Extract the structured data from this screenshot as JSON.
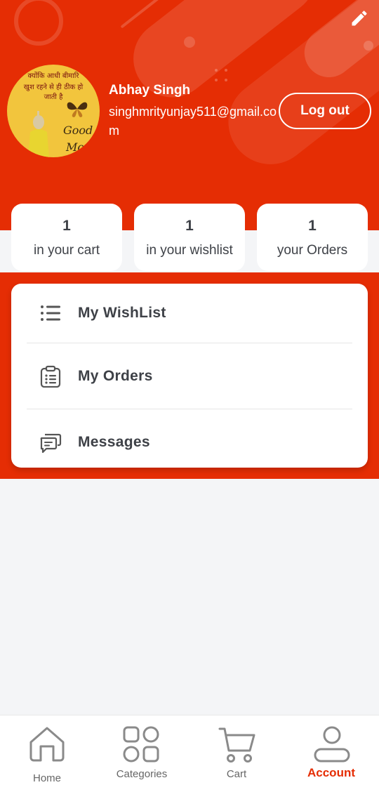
{
  "header": {
    "user_name": "Abhay Singh",
    "user_email": "singhmrityunjay511@gmail.com",
    "logout_label": "Log out",
    "edit_icon": "pencil-icon",
    "avatar_text": {
      "line1": "क्योंकि आधी बीमारि",
      "line2": "खुश रहने से ही ठीक हो",
      "line3": "जाती है",
      "good": "Good",
      "mor": "Mor"
    }
  },
  "stats": [
    {
      "value": "1",
      "label": "in your cart"
    },
    {
      "value": "1",
      "label": "in your wishlist"
    },
    {
      "value": "1",
      "label": "your Orders"
    }
  ],
  "menu": [
    {
      "label": "My WishList",
      "icon": "list-icon"
    },
    {
      "label": "My Orders",
      "icon": "clipboard-list-icon"
    },
    {
      "label": "Messages",
      "icon": "chat-bubbles-icon"
    }
  ],
  "bottom_nav": [
    {
      "label": "Home",
      "icon": "home-icon",
      "active": false
    },
    {
      "label": "Categories",
      "icon": "categories-icon",
      "active": false
    },
    {
      "label": "Cart",
      "icon": "cart-icon",
      "active": false
    },
    {
      "label": "Account",
      "icon": "account-icon",
      "active": true
    }
  ],
  "colors": {
    "accent": "#e52d04",
    "text_dark": "#3e4147",
    "nav_inactive": "#8a8a8a",
    "background": "#f4f5f7"
  }
}
